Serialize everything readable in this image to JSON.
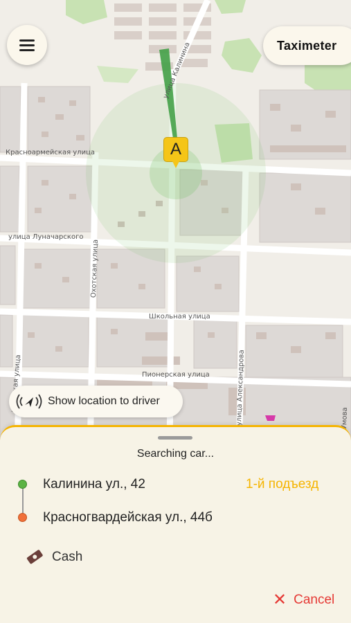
{
  "map": {
    "streets": {
      "kalinina": "улица Калинина",
      "krasnoarmeyskaya": "Красноармейская улица",
      "lunacharskogo": "улица Луначарского",
      "okhotskaya": "Охотская улица",
      "shkolnaya": "Школьная улица",
      "pionerskaya": "Пионерская улица",
      "aleksandrova": "улица Александрова",
      "chetinskaya": "чтинская улица",
      "umova": "Умова"
    },
    "pin_label": "A",
    "pin_color": "#f5c518"
  },
  "header": {
    "menu_icon": "hamburger-menu-icon",
    "taximeter_label": "Taximeter"
  },
  "show_location": {
    "icon": "location-broadcast-icon",
    "label": "Show location to driver"
  },
  "order": {
    "status": "Searching car...",
    "pickup_address": "Калинина ул., 42",
    "pickup_entrance": "1-й подъезд",
    "dropoff_address": "Красногвардейская ул., 44б",
    "payment_icon": "cash-icon",
    "payment_label": "Cash",
    "cancel_label": "Cancel"
  },
  "colors": {
    "accent": "#f5b400",
    "pickup_dot": "#5bb344",
    "dropoff_dot": "#f0703a",
    "cancel": "#e53935"
  }
}
